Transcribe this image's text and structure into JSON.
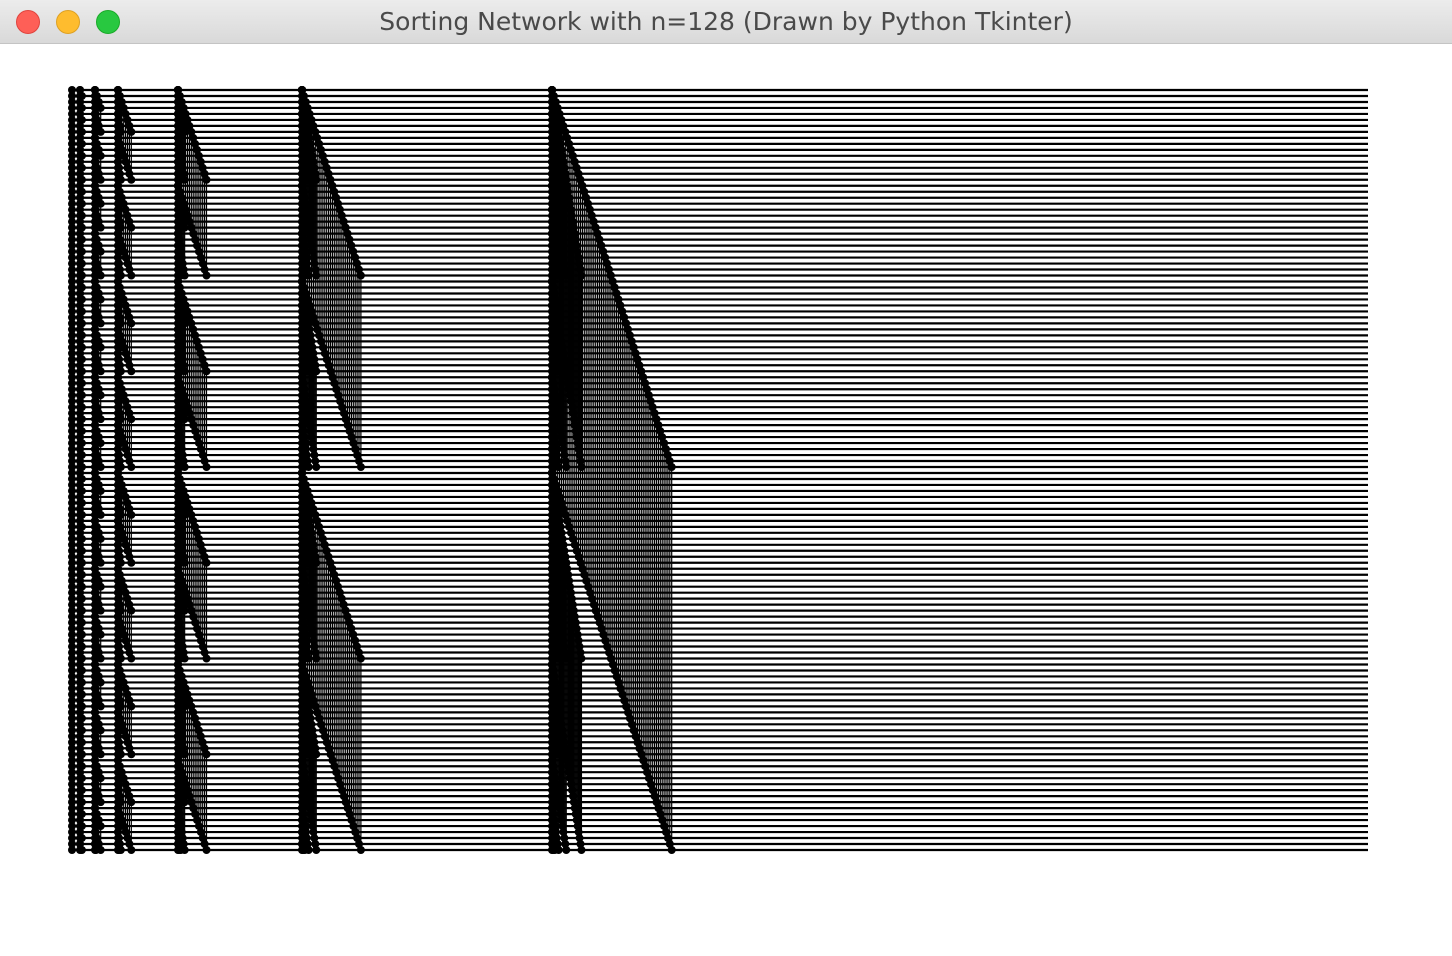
{
  "window": {
    "title": "Sorting Network with n=128 (Drawn by Python Tkinter)",
    "buttons": [
      "close",
      "minimize",
      "maximize"
    ]
  },
  "network": {
    "n": 128,
    "type": "bitonic sorting network",
    "line_color": "#000000",
    "background_color": "#ffffff"
  }
}
